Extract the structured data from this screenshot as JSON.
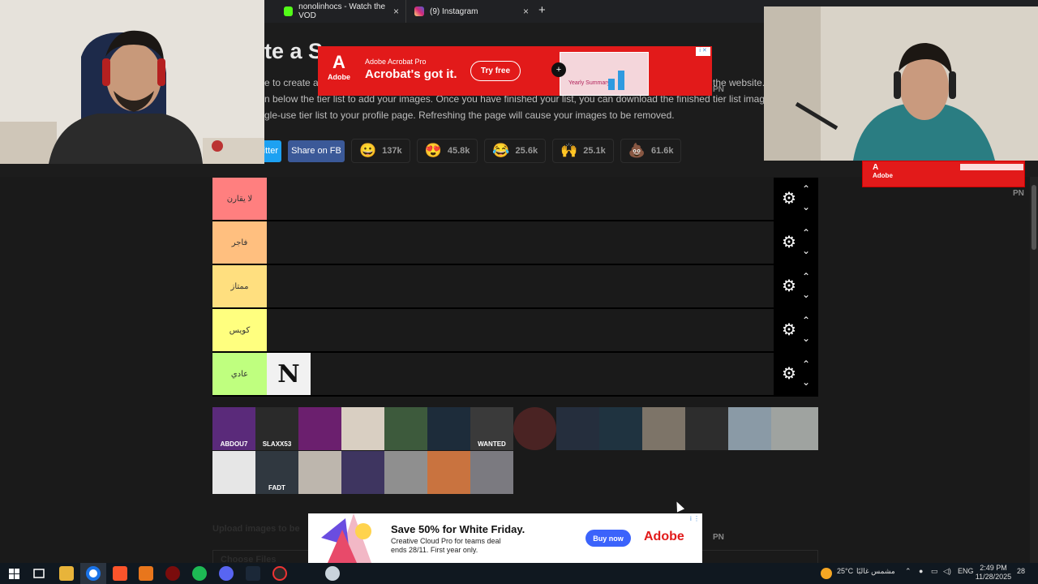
{
  "browser": {
    "tabs": [
      {
        "title": "nonolinhocs - Watch the VOD",
        "icon": "kick-icon",
        "color": "#53fc18"
      },
      {
        "title": "(9) Instagram",
        "icon": "instagram-icon",
        "color": "#d62976"
      }
    ],
    "new_tab": "+",
    "close_glyph": "×"
  },
  "page": {
    "title_fragment": "te a S",
    "desc_line1": "e to create a s",
    "desc_line1_end": "the website.",
    "desc_line2": "n below the tier list to add your images. Once you have finished your list, you can download the finished tier list image. It is",
    "desc_line3": "gle-use tier list to your profile page. Refreshing the page will cause your images to be removed.",
    "twitter_label": "itter",
    "fb_label": "Share on FB",
    "reactions": [
      {
        "emoji": "😀",
        "count": "137k"
      },
      {
        "emoji": "😍",
        "count": "45.8k"
      },
      {
        "emoji": "😂",
        "count": "25.6k"
      },
      {
        "emoji": "🙌",
        "count": "25.1k"
      },
      {
        "emoji": "💩",
        "count": "61.6k"
      }
    ]
  },
  "ad_top": {
    "logo": "A",
    "logo_word": "Adobe",
    "brand": "Adobe Acrobat Pro",
    "headline": "Acrobat's got it.",
    "cta": "Try free",
    "doc_text": "Yearly Summary",
    "plus": "+",
    "info": "i ✕",
    "pn": "PN"
  },
  "ad_right": {
    "logo": "A",
    "word": "Adobe",
    "pn": "PN"
  },
  "tiers": [
    {
      "label": "لا يقارن",
      "color": "#ff7f7f"
    },
    {
      "label": "فاجر",
      "color": "#ffbf7f"
    },
    {
      "label": "ممتاز",
      "color": "#ffdf7f"
    },
    {
      "label": "كويس",
      "color": "#ffff7f"
    },
    {
      "label": "عادي",
      "color": "#bfff7f"
    }
  ],
  "tier_controls": {
    "gear": "⚙",
    "up": "⌃",
    "down": "⌄"
  },
  "placed_item": {
    "logo": "N"
  },
  "pool_labels": [
    "ABDOU7",
    "SLAXX53",
    "",
    "",
    "",
    "",
    "WANTED",
    "",
    "",
    "",
    "",
    "",
    "",
    "",
    "",
    "FADT",
    "",
    "",
    "",
    "",
    ""
  ],
  "ad_bottom": {
    "headline": "Save 50% for White Friday.",
    "sub": "Creative Cloud Pro for teams deal ends 28/11. First year only.",
    "cta": "Buy now",
    "brand": "Adobe",
    "info": "i ⋮",
    "pn": "PN"
  },
  "upload": {
    "label": "Upload images to be",
    "button": "Choose Files"
  },
  "taskbar": {
    "weather": "25°C",
    "weather_text": "مشمس غالبًا",
    "lang": "ENG",
    "time": "2:49 PM",
    "date": "11/28/2025",
    "notifications": "28"
  }
}
